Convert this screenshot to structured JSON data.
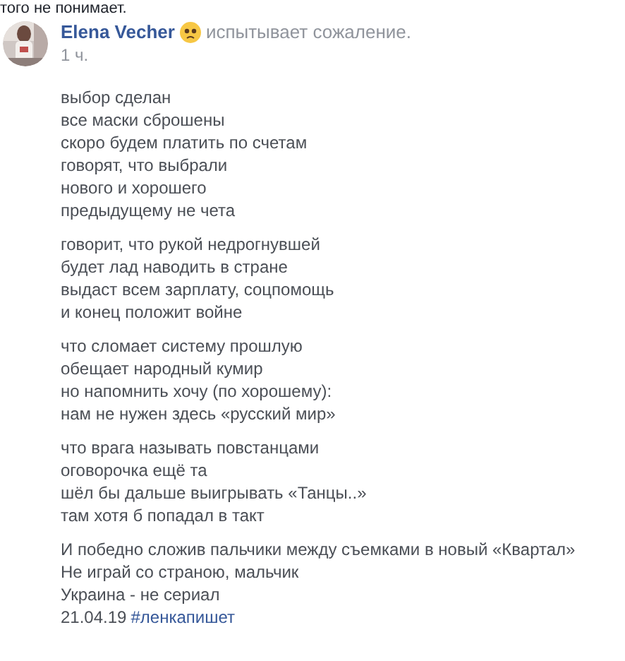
{
  "previous_comment_tail": "того не понимает.",
  "post": {
    "author": "Elena Vecher",
    "feeling": "испытывает сожаление.",
    "time": "1 ч.",
    "stanzas": [
      [
        "выбор сделан",
        "все маски сброшены",
        "скоро будем платить по счетам",
        "говорят, что выбрали",
        "нового и хорошего",
        "предыдущему не чета"
      ],
      [
        "говорит, что рукой недрогнувшей",
        "будет лад наводить в стране",
        "выдаст всем зарплату, соцпомощь",
        "и конец положит войне"
      ],
      [
        "что сломает систему прошлую",
        "обещает народный кумир",
        "но напомнить хочу (по хорошему):",
        "нам не нужен здесь «русский мир»"
      ],
      [
        "что врага называть повстанцами",
        "оговорочка ещё та",
        "шёл бы дальше выигрывать «Танцы..»",
        "там хотя б попадал в такт"
      ],
      [
        "И победно сложив пальчики между съемками в новый «Квартал»",
        "Не играй со страною, мальчик",
        "Украина - не сериал"
      ]
    ],
    "date": "21.04.19",
    "hashtag": "#ленкапишет"
  }
}
